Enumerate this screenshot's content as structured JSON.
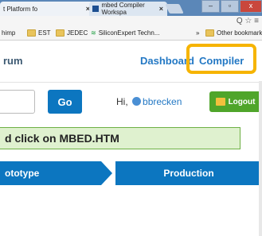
{
  "tabs": [
    {
      "label": "t Platform fo"
    },
    {
      "label": "mbed Compiler Workspa"
    }
  ],
  "window": {
    "close": "x",
    "restore": "▫",
    "minimize": "–"
  },
  "address_bar": {
    "icons": "Q ☆ ≡"
  },
  "bookmarks": {
    "items": [
      {
        "label": "himp"
      },
      {
        "label": "EST"
      },
      {
        "label": "JEDEC"
      },
      {
        "label": "SiliconExpert Techn..."
      }
    ],
    "overflow": "»",
    "other": "Other bookmarks"
  },
  "header": {
    "logo_partial": "rum",
    "nav": {
      "dashboard": "Dashboard",
      "compiler": "Compiler"
    }
  },
  "userbar": {
    "go": "Go",
    "greeting": "Hi,",
    "username": "bbrecken",
    "logout": "Logout"
  },
  "notice": {
    "text": "d click on MBED.HTM"
  },
  "steps": {
    "prototype": "ototype",
    "production": "Production"
  },
  "colors": {
    "accent": "#0c76c0",
    "highlight": "#f6b400",
    "logout": "#4fa52a",
    "notice_bg": "#dff1cf"
  }
}
